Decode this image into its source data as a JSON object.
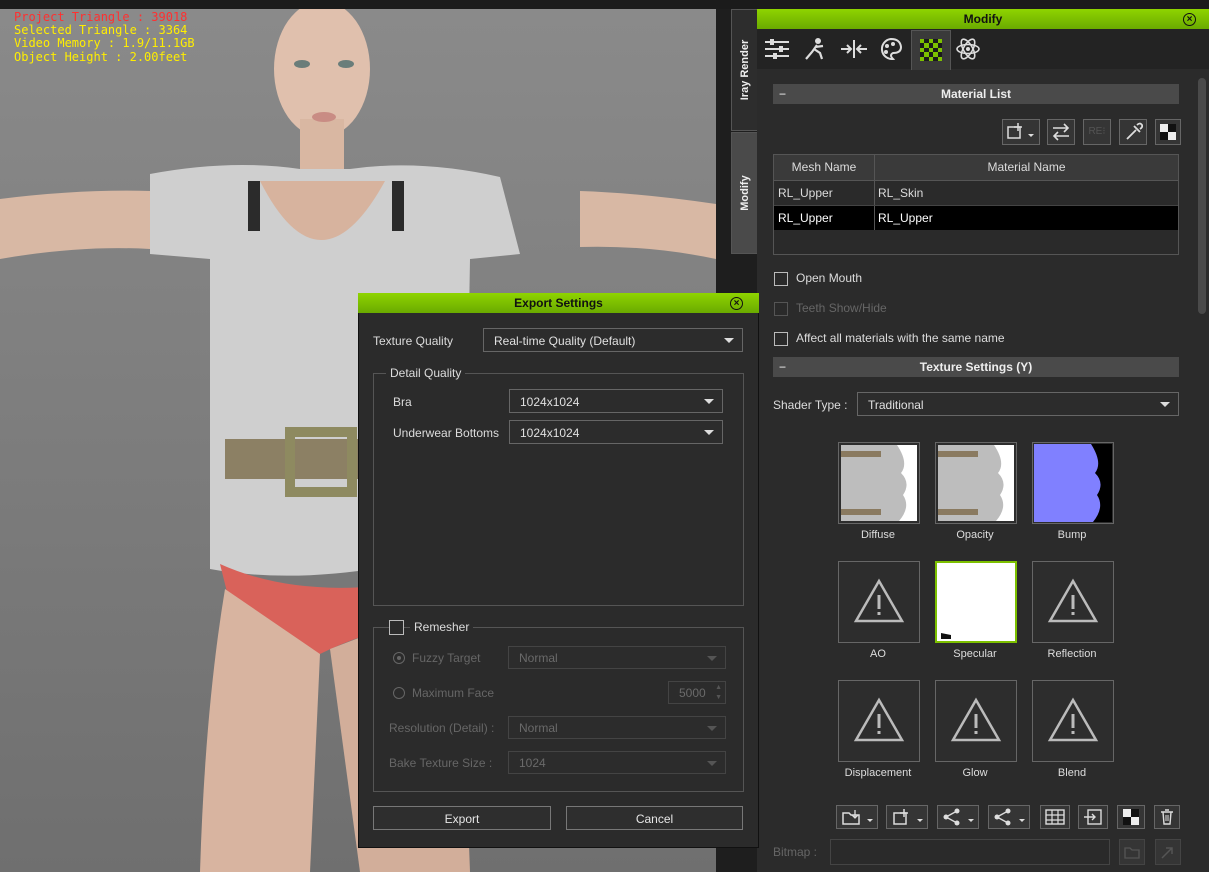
{
  "viewport": {
    "stats": [
      {
        "text": "Project Triangle : 39018",
        "color": "#ff3030"
      },
      {
        "text": "Selected Triangle : 3364",
        "color": "#ffee00"
      },
      {
        "text": "Video Memory : 1.9/11.1GB",
        "color": "#ffee00"
      },
      {
        "text": "Object Height : 2.00feet",
        "color": "#ffee00"
      }
    ]
  },
  "side_tabs": {
    "iray": "Iray Render",
    "modify": "Modify"
  },
  "modify": {
    "title": "Modify",
    "tabs": [
      "sliders-icon",
      "motion-icon",
      "morph-icon",
      "palette-icon",
      "material-icon",
      "physics-icon"
    ],
    "material_list": {
      "header": "Material List",
      "columns": [
        "Mesh Name",
        "Material Name"
      ],
      "rows": [
        {
          "mesh": "RL_Upper",
          "material": "RL_Skin"
        },
        {
          "mesh": "RL_Upper",
          "material": "RL_Upper"
        }
      ]
    },
    "open_mouth": "Open Mouth",
    "teeth_show_hide": "Teeth Show/Hide",
    "affect_all": "Affect all materials with the same name",
    "texture_settings": {
      "header": "Texture Settings  (Y)",
      "shader_label": "Shader Type :",
      "shader_value": "Traditional",
      "channels": [
        "Diffuse",
        "Opacity",
        "Bump",
        "AO",
        "Specular",
        "Reflection",
        "Displacement",
        "Glow",
        "Blend"
      ]
    },
    "bitmap_label": "Bitmap :"
  },
  "dialog": {
    "title": "Export Settings",
    "texture_quality_label": "Texture Quality",
    "texture_quality_value": "Real-time Quality (Default)",
    "detail_quality": {
      "legend": "Detail Quality",
      "items": [
        {
          "label": "Bra",
          "value": "1024x1024"
        },
        {
          "label": "Underwear Bottoms",
          "value": "1024x1024"
        }
      ]
    },
    "remesher": {
      "label": "Remesher",
      "fuzzy_target_label": "Fuzzy Target",
      "fuzzy_target_value": "Normal",
      "maximum_face_label": "Maximum Face",
      "maximum_face_value": "5000",
      "resolution_label": "Resolution (Detail) :",
      "resolution_value": "Normal",
      "bake_label": "Bake Texture Size :",
      "bake_value": "1024"
    },
    "export_button": "Export",
    "cancel_button": "Cancel"
  },
  "colors": {
    "accent": "#7cc000",
    "selected_row": "#000000"
  }
}
